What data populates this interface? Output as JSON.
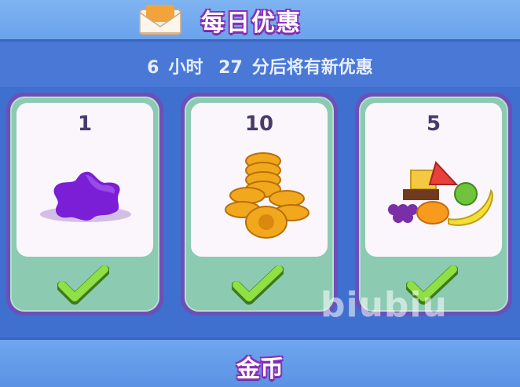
{
  "header": {
    "title": "每日优惠",
    "icon": "envelope-icon"
  },
  "timer": {
    "hours": "6",
    "hours_unit": "小时",
    "minutes": "27",
    "suffix": "分后将有新优惠"
  },
  "offers": [
    {
      "quantity": "1",
      "item": "purple-star-candy-icon",
      "claimed": true
    },
    {
      "quantity": "10",
      "item": "gold-coins-icon",
      "claimed": true
    },
    {
      "quantity": "5",
      "item": "fruit-basket-icon",
      "claimed": true
    }
  ],
  "watermark": "biubiu",
  "footer": {
    "label": "金币"
  },
  "colors": {
    "background": "#3f6fcf",
    "card_frame": "#6d4fb9",
    "card_base": "#8ccab2",
    "check": "#7fd63a",
    "title_outline": "#8b2fb8"
  }
}
